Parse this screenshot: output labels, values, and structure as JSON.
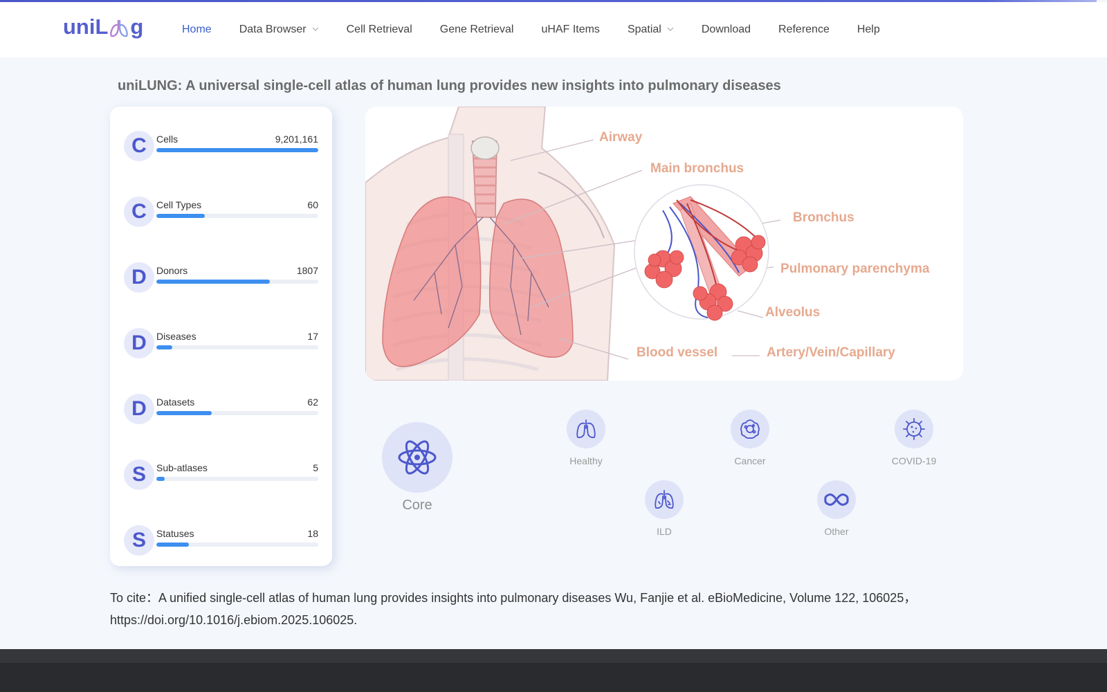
{
  "logo": {
    "prefix": "uniL",
    "suffix": "g"
  },
  "nav": {
    "items": [
      {
        "label": "Home",
        "active": true
      },
      {
        "label": "Data Browser",
        "dropdown": true
      },
      {
        "label": "Cell Retrieval"
      },
      {
        "label": "Gene Retrieval"
      },
      {
        "label": "uHAF Items"
      },
      {
        "label": "Spatial",
        "dropdown": true
      },
      {
        "label": "Download"
      },
      {
        "label": "Reference"
      },
      {
        "label": "Help"
      }
    ]
  },
  "page_title": "uniLUNG: A universal single-cell atlas of human lung provides new insights into pulmonary diseases",
  "stats": [
    {
      "letter": "C",
      "label": "Cells",
      "value": "9,201,161",
      "progress": 1.0
    },
    {
      "letter": "C",
      "label": "Cell Types",
      "value": "60",
      "progress": 0.3
    },
    {
      "letter": "D",
      "label": "Donors",
      "value": "1807",
      "progress": 0.7
    },
    {
      "letter": "D",
      "label": "Diseases",
      "value": "17",
      "progress": 0.1
    },
    {
      "letter": "D",
      "label": "Datasets",
      "value": "62",
      "progress": 0.34
    },
    {
      "letter": "S",
      "label": "Sub-atlases",
      "value": "5",
      "progress": 0.05
    },
    {
      "letter": "S",
      "label": "Statuses",
      "value": "18",
      "progress": 0.2
    }
  ],
  "illustration": {
    "labels": {
      "airway": "Airway",
      "main_bronchus": "Main bronchus",
      "bronchus": "Bronchus",
      "parenchyma": "Pulmonary parenchyma",
      "alveolus": "Alveolus",
      "blood_vessel": "Blood vessel",
      "artery": "Artery/Vein/Capillary"
    }
  },
  "categories": {
    "core": {
      "label": "Core",
      "icon": "atom-icon"
    },
    "healthy": {
      "label": "Healthy",
      "icon": "lungs-icon"
    },
    "cancer": {
      "label": "Cancer",
      "icon": "cancer-cell-icon"
    },
    "covid": {
      "label": "COVID-19",
      "icon": "virus-icon"
    },
    "ild": {
      "label": "ILD",
      "icon": "lungs-damaged-icon"
    },
    "other": {
      "label": "Other",
      "icon": "infinity-icon"
    }
  },
  "citation": "To cite：A unified single-cell atlas of human lung provides insights into pulmonary diseases Wu, Fanjie et al. eBioMedicine, Volume 122, 106025，https://doi.org/10.1016/j.ebiom.2025.106025.",
  "colors": {
    "accent": "#4c58cc",
    "progress": "#3d8ff0",
    "bubble": "#dfe3f7",
    "label_salmon": "#e6a98f"
  }
}
